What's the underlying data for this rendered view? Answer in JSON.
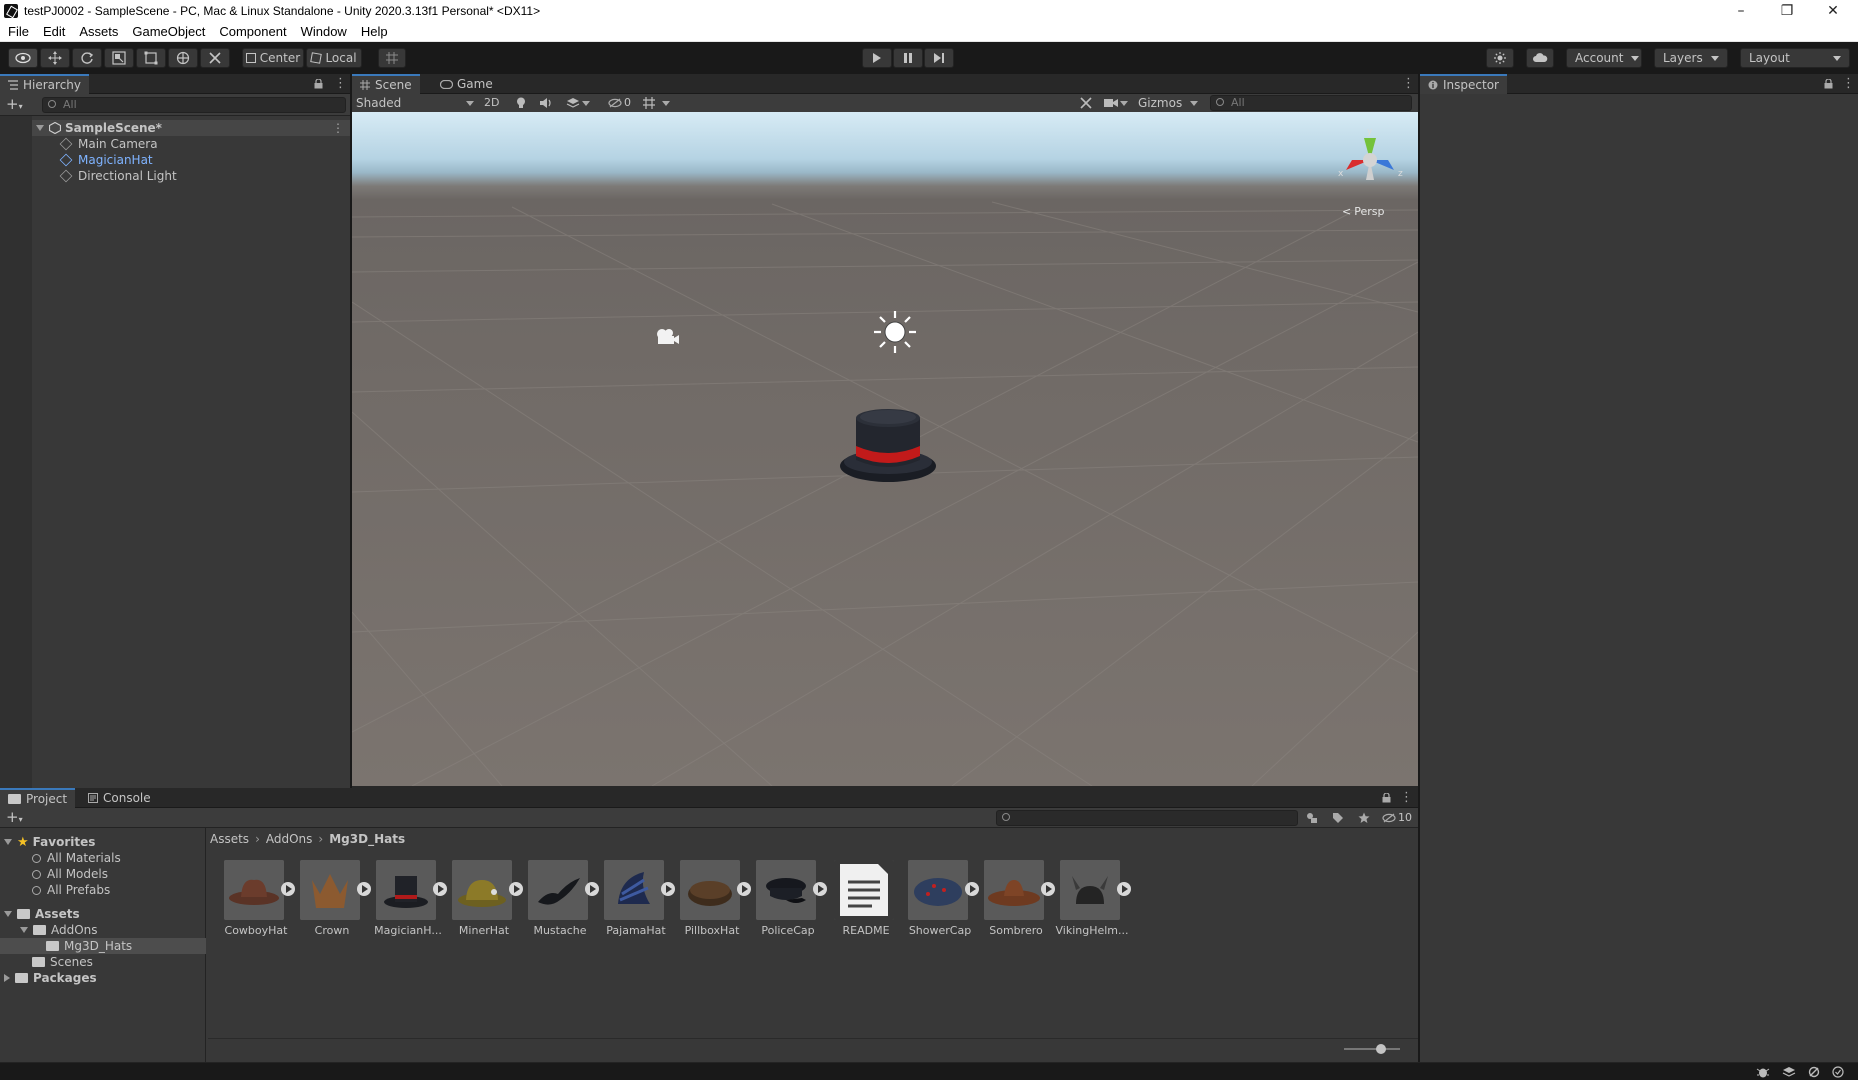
{
  "window": {
    "title": "testPJ0002 - SampleScene - PC, Mac & Linux Standalone - Unity 2020.3.13f1 Personal* <DX11>",
    "min": "–",
    "max": "❐",
    "close": "✕"
  },
  "menu": [
    "File",
    "Edit",
    "Assets",
    "GameObject",
    "Component",
    "Window",
    "Help"
  ],
  "toolbar": {
    "pivot": "Center",
    "space": "Local",
    "account": "Account",
    "layers": "Layers",
    "layout": "Layout"
  },
  "hierarchy": {
    "tab": "Hierarchy",
    "search_placeholder": "All",
    "scene": "SampleScene*",
    "items": [
      "Main Camera",
      "MagicianHat",
      "Directional Light"
    ]
  },
  "scene": {
    "tabs": [
      "Scene",
      "Game"
    ],
    "shading": "Shaded",
    "mode2d": "2D",
    "hidden_count": "0",
    "gizmos": "Gizmos",
    "search_placeholder": "All",
    "persp": "Persp"
  },
  "inspector": {
    "tab": "Inspector"
  },
  "project": {
    "tabs": [
      "Project",
      "Console"
    ],
    "count": "10",
    "breadcrumb": [
      "Assets",
      "AddOns",
      "Mg3D_Hats"
    ],
    "favorites": {
      "label": "Favorites",
      "items": [
        "All Materials",
        "All Models",
        "All Prefabs"
      ]
    },
    "tree": {
      "assets": "Assets",
      "addons": "AddOns",
      "hats": "Mg3D_Hats",
      "scenes": "Scenes",
      "packages": "Packages"
    },
    "assets": [
      "CowboyHat",
      "Crown",
      "MagicianH...",
      "MinerHat",
      "Mustache",
      "PajamaHat",
      "PillboxHat",
      "PoliceCap",
      "README",
      "ShowerCap",
      "Sombrero",
      "VikingHelm..."
    ]
  },
  "colors": {
    "accent": "#3a79bb",
    "selected_item": "#7fb3ff",
    "panel_bg": "#383838",
    "dark_bg": "#191919"
  }
}
